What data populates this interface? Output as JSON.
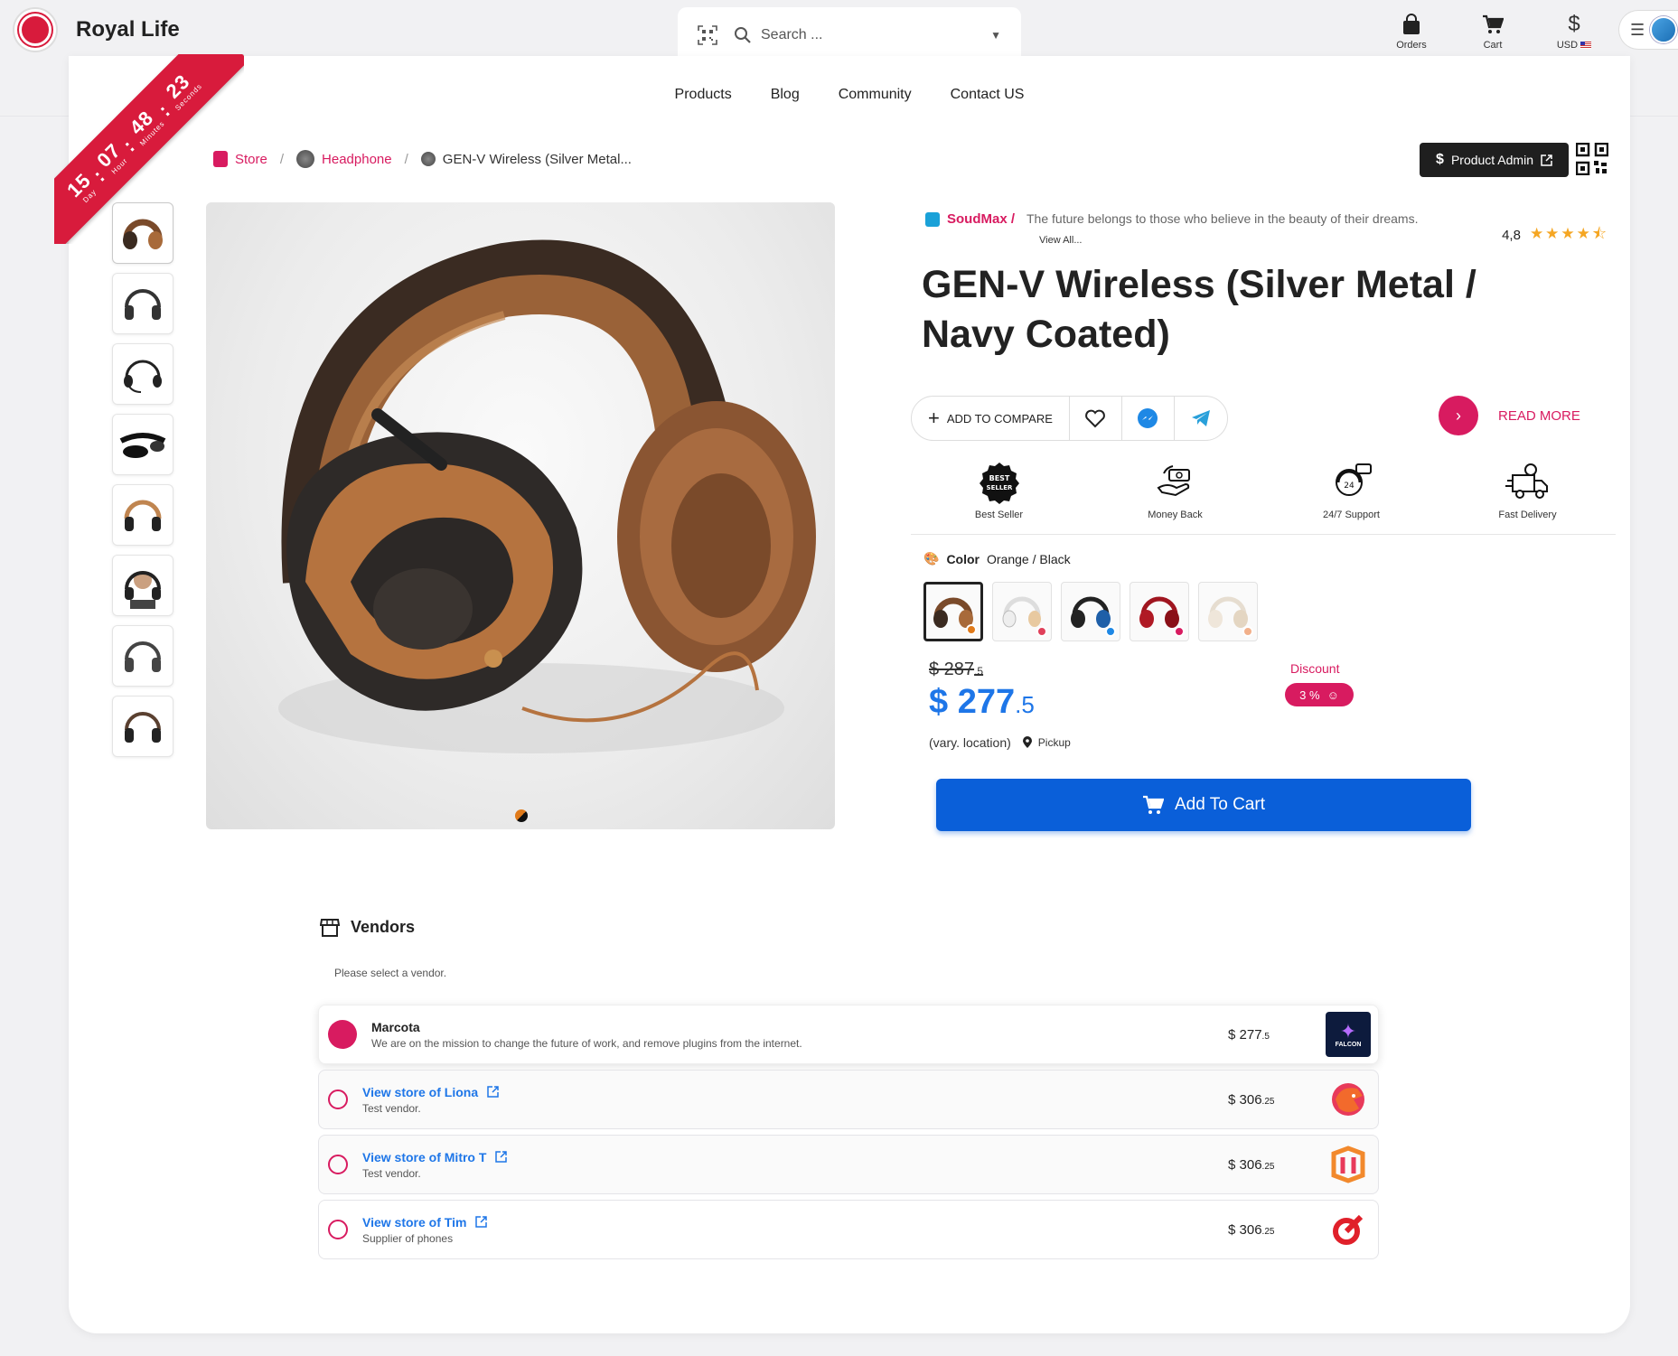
{
  "app": {
    "brand_name": "Royal Life"
  },
  "search": {
    "placeholder": "Search ..."
  },
  "top_actions": [
    {
      "label": "Orders",
      "icon": "bag-icon"
    },
    {
      "label": "Cart",
      "icon": "cart-icon"
    },
    {
      "label": "USD",
      "icon": "dollar-icon"
    }
  ],
  "nav": [
    "Products",
    "Blog",
    "Community",
    "Contact US"
  ],
  "countdown": {
    "day": "15",
    "hour": "07",
    "minutes": "48",
    "seconds": "23",
    "day_label": "Day",
    "hour_label": "Hour",
    "minutes_label": "Minutes",
    "seconds_label": "Seconds"
  },
  "breadcrumb": {
    "store": "Store",
    "category": "Headphone",
    "current": "GEN-V Wireless (Silver Metal..."
  },
  "admin": {
    "label": "Product Admin"
  },
  "vendor": {
    "name": "SoudMax /",
    "slogan": "The future belongs to those who believe in the beauty of their dreams.",
    "view_all": "View All..."
  },
  "rating": {
    "value": "4,8",
    "stars": "★★★★⯪"
  },
  "product": {
    "title": "GEN-V Wireless (Silver Metal / Navy Coated)",
    "add_compare": "ADD TO COMPARE",
    "read_more": "READ MORE",
    "color_label": "Color",
    "color_value": "Orange / Black",
    "old_price": "$ 287",
    "old_price_dec": ".5",
    "price": "$ 277",
    "price_dec": ".5",
    "vary": "(vary. location)",
    "pickup": "Pickup",
    "discount_label": "Discount",
    "discount_value": "3 %",
    "add_to_cart": "Add To Cart"
  },
  "features": [
    "Best Seller",
    "Money Back",
    "24/7 Support",
    "Fast Delivery"
  ],
  "vendors": {
    "title": "Vendors",
    "subtitle": "Please select a vendor.",
    "rows": [
      {
        "name": "Marcota",
        "desc": "We are on the mission to change the future of work, and remove plugins from the internet.",
        "price": "$ 277",
        "price_dec": ".5",
        "logo_text": "FALCON"
      },
      {
        "name": "View store of Liona",
        "desc": "Test vendor.",
        "price": "$ 306",
        "price_dec": ".25"
      },
      {
        "name": "View store of Mitro T",
        "desc": "Test vendor.",
        "price": "$ 306",
        "price_dec": ".25"
      },
      {
        "name": "View store of Tim",
        "desc": "Supplier of phones",
        "price": "$ 306",
        "price_dec": ".25"
      }
    ]
  },
  "colors": {
    "accent": "#d81b60",
    "primary": "#0a5fd9",
    "ribbon": "#d81b3c"
  }
}
